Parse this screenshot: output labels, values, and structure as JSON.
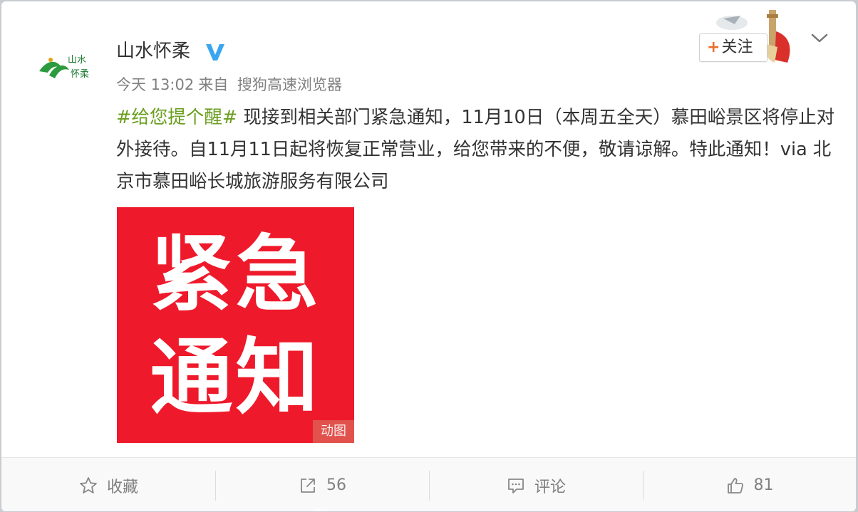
{
  "post": {
    "user": {
      "name": "山水怀柔",
      "avatar_text": "山水怀柔",
      "verified": true
    },
    "meta": {
      "time": "今天 13:02",
      "from": "来自",
      "source": "搜狗高速浏览器"
    },
    "text": {
      "hashtag": "#给您提个醒#",
      "body": " 现接到相关部门紧急通知，11月10日（本周五全天）慕田峪景区将停止对外接待。自11月11日起将恢复正常营业，给您带来的不便，敬请谅解。特此通知！via 北京市慕田峪长城旅游服务有限公司"
    },
    "media": {
      "line1": "紧急",
      "line2": "通知",
      "badge": "动图",
      "bg_color": "#ee1a2b"
    },
    "follow": {
      "plus": "+",
      "label": "关注"
    },
    "menu_icon": "chevron-down-icon"
  },
  "actions": {
    "favorite": {
      "label": "收藏",
      "icon": "star-icon"
    },
    "repost": {
      "label": "56",
      "icon": "share-icon"
    },
    "comment": {
      "label": "评论",
      "icon": "comment-icon"
    },
    "like": {
      "label": "81",
      "icon": "thumbs-up-icon"
    }
  },
  "colors": {
    "hashtag": "#6a9e1f",
    "verified": "#3ba6f0",
    "follow_plus": "#e8702a"
  }
}
